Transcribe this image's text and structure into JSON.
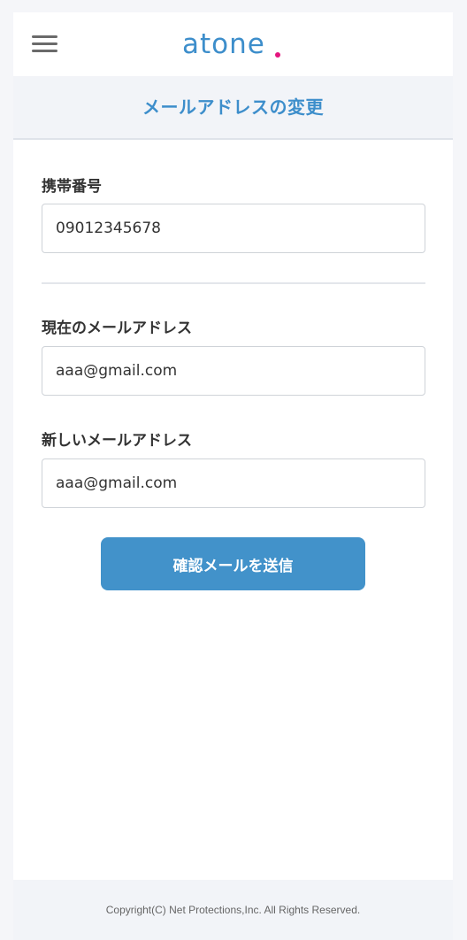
{
  "header": {
    "menu_icon": "hamburger-menu-icon",
    "logo_text": "atone",
    "logo_dot_color": "#e4157e",
    "brand_color": "#3d8ecb"
  },
  "page": {
    "title": "メールアドレスの変更"
  },
  "form": {
    "phone": {
      "label": "携帯番号",
      "value": "09012345678"
    },
    "current_email": {
      "label": "現在のメールアドレス",
      "value": "aaa@gmail.com"
    },
    "new_email": {
      "label": "新しいメールアドレス",
      "value": "aaa@gmail.com"
    },
    "submit_label": "確認メールを送信"
  },
  "footer": {
    "copyright": "Copyright(C) Net Protections,Inc. All Rights Reserved."
  }
}
